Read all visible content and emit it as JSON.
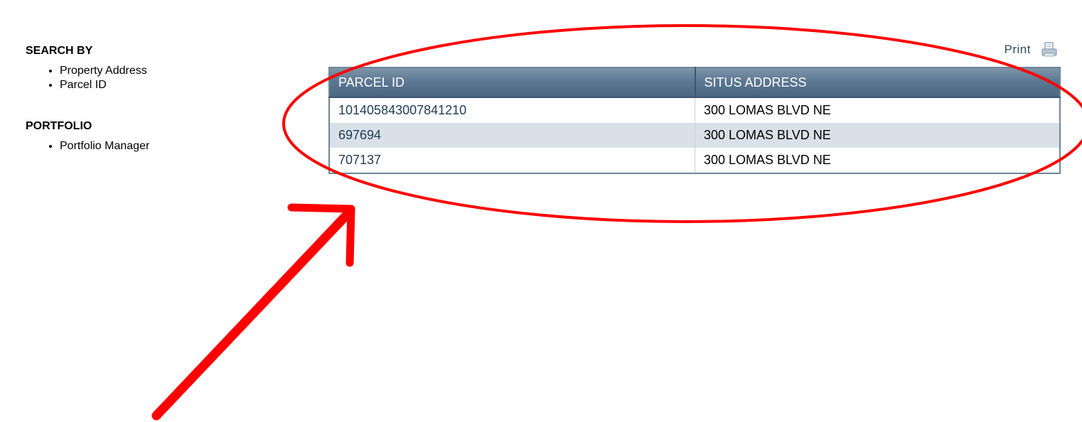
{
  "sidebar": {
    "search_heading": "SEARCH BY",
    "search_items": [
      "Property Address",
      "Parcel ID"
    ],
    "portfolio_heading": "PORTFOLIO",
    "portfolio_items": [
      "Portfolio Manager"
    ]
  },
  "print": {
    "label": "Print",
    "icon": "printer-icon"
  },
  "table": {
    "headers": [
      "PARCEL ID",
      "SITUS ADDRESS"
    ],
    "rows": [
      {
        "parcel_id": "101405843007841210",
        "situs_address": "300 LOMAS BLVD NE"
      },
      {
        "parcel_id": "697694",
        "situs_address": "300 LOMAS BLVD NE"
      },
      {
        "parcel_id": "707137",
        "situs_address": "300 LOMAS BLVD NE"
      }
    ]
  },
  "colors": {
    "header_bg": "#5c7893",
    "alt_row_bg": "#d9e0e7",
    "link_text": "#1e3d57",
    "annotation": "#ff0000"
  }
}
